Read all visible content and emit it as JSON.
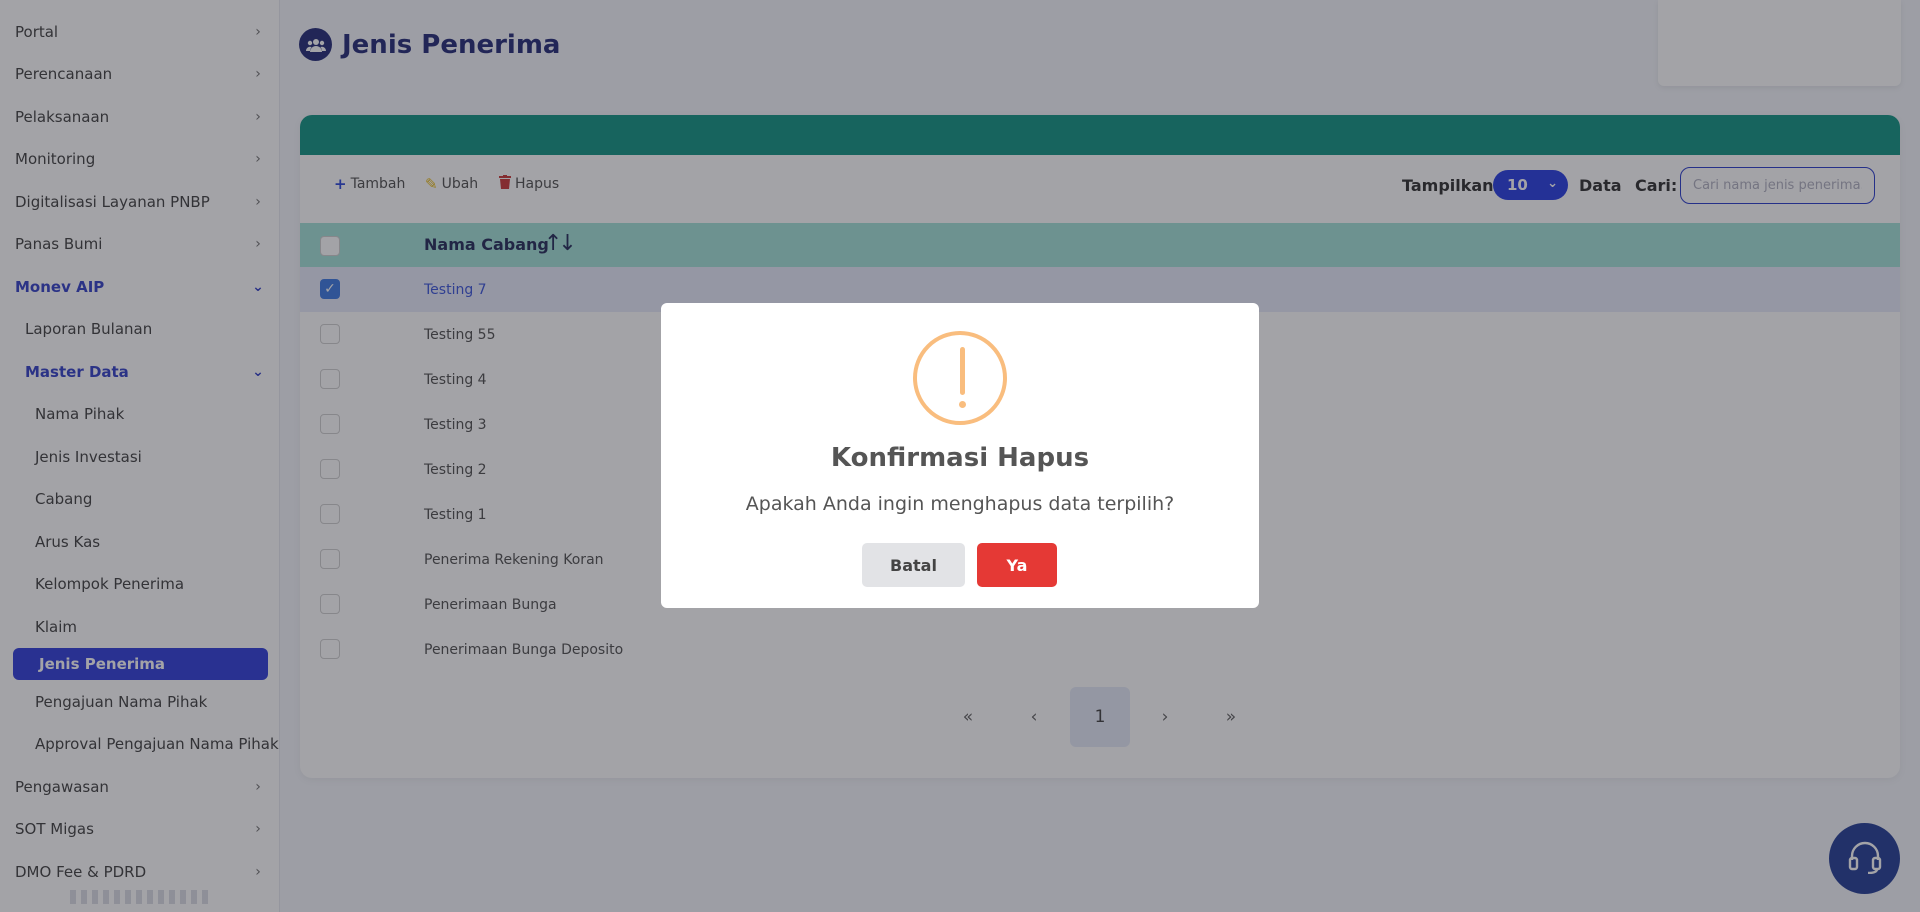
{
  "sidebar": {
    "items": [
      {
        "label": "Portal",
        "level": 0,
        "chevron": "›"
      },
      {
        "label": "Perencanaan",
        "level": 0,
        "chevron": "›"
      },
      {
        "label": "Pelaksanaan",
        "level": 0,
        "chevron": "›"
      },
      {
        "label": "Monitoring",
        "level": 0,
        "chevron": "›"
      },
      {
        "label": "Digitalisasi Layanan PNBP",
        "level": 0,
        "chevron": "›"
      },
      {
        "label": "Panas Bumi",
        "level": 0,
        "chevron": "›"
      },
      {
        "label": "Monev AIP",
        "level": 0,
        "chevron": "⌄"
      },
      {
        "label": "Laporan Bulanan",
        "level": 1
      },
      {
        "label": "Master Data",
        "level": 1,
        "chevron": "⌄"
      },
      {
        "label": "Nama Pihak",
        "level": 2
      },
      {
        "label": "Jenis Investasi",
        "level": 2
      },
      {
        "label": "Cabang",
        "level": 2
      },
      {
        "label": "Arus Kas",
        "level": 2
      },
      {
        "label": "Kelompok Penerima",
        "level": 2
      },
      {
        "label": "Klaim",
        "level": 2
      },
      {
        "label": "Jenis Penerima",
        "level": 2
      },
      {
        "label": "Pengajuan Nama Pihak",
        "level": 2
      },
      {
        "label": "Approval Pengajuan Nama Pihak",
        "level": 2
      },
      {
        "label": "Pengawasan",
        "level": 0,
        "chevron": "›"
      },
      {
        "label": "SOT Migas",
        "level": 0,
        "chevron": "›"
      },
      {
        "label": "DMO Fee & PDRD",
        "level": 0,
        "chevron": "›"
      }
    ]
  },
  "header": {
    "title": "Jenis Penerima",
    "icon": "users-icon"
  },
  "toolbar": {
    "add_label": "Tambah",
    "edit_label": "Ubah",
    "delete_label": "Hapus",
    "show_label": "Tampilkan",
    "page_size": "10",
    "data_label": "Data",
    "search_label": "Cari:",
    "search_placeholder": "Cari nama jenis penerima..."
  },
  "table": {
    "column": "Nama Cabang",
    "rows": [
      {
        "name": "Testing 7",
        "checked": true
      },
      {
        "name": "Testing 55",
        "checked": false
      },
      {
        "name": "Testing 4",
        "checked": false
      },
      {
        "name": "Testing 3",
        "checked": false
      },
      {
        "name": "Testing 2",
        "checked": false
      },
      {
        "name": "Testing 1",
        "checked": false
      },
      {
        "name": "Penerima Rekening Koran",
        "checked": false
      },
      {
        "name": "Penerimaan Bunga",
        "checked": false
      },
      {
        "name": "Penerimaan Bunga Deposito",
        "checked": false
      }
    ]
  },
  "pagination": {
    "first": "«",
    "prev": "‹",
    "current": "1",
    "next": "›",
    "last": "»"
  },
  "modal": {
    "title": "Konfirmasi Hapus",
    "message": "Apakah Anda ingin menghapus data terpilih?",
    "cancel_label": "Batal",
    "confirm_label": "Ya"
  },
  "colors": {
    "primary": "#1830e0",
    "header_teal": "#008c7a",
    "danger": "#e53935",
    "warning": "#f9bd7e"
  }
}
